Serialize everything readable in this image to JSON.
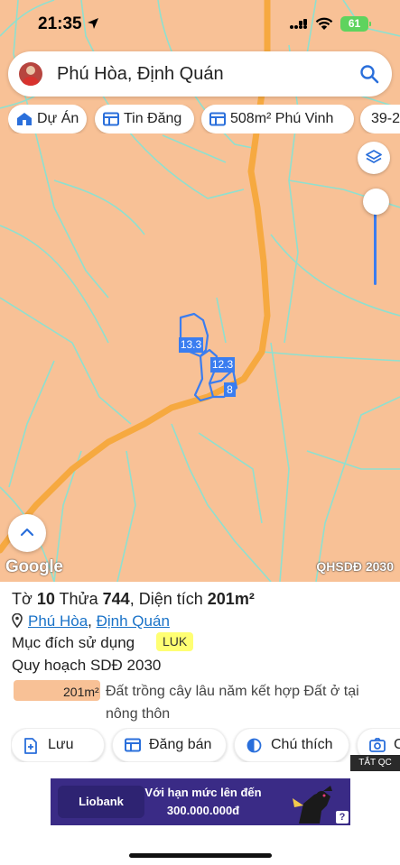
{
  "status": {
    "time": "21:35",
    "battery": "61"
  },
  "search": {
    "text": "Phú Hòa, Định Quán"
  },
  "chips": [
    {
      "label": "Dự Án",
      "icon": "house-icon"
    },
    {
      "label": "Tin Đăng",
      "icon": "listing-icon"
    },
    {
      "label": "508m² Phú Vinh",
      "icon": "listing-icon"
    },
    {
      "label": "39-2",
      "icon": "listing-icon"
    }
  ],
  "map": {
    "parcel_labels": [
      "13.3",
      "12.3",
      "8"
    ],
    "google": "Google",
    "layer_name": "QHSDĐ 2030",
    "colors": {
      "land": "#f8c196",
      "road": "#f6a940",
      "boundary": "#8fe0cf",
      "parcel": "#3a7df0"
    }
  },
  "panel": {
    "to_label": "Tờ",
    "to_value": "10",
    "thua_label": "Thửa",
    "thua_value": "744",
    "area_label": "Diện tích",
    "area_value": "201m²",
    "location_parts": [
      "Phú Hòa",
      "Định Quán"
    ],
    "purpose_label": "Mục đích sử dụng",
    "purpose_badge": "LUK",
    "plan_label": "Quy hoạch SDĐ 2030",
    "plan_area": "201m²",
    "plan_desc": "Đất trồng cây lâu năm kết hợp Đất ở tại nông thôn"
  },
  "actions": [
    {
      "label": "Lưu",
      "icon": "add-file-icon"
    },
    {
      "label": "Đăng bán",
      "icon": "listing-icon"
    },
    {
      "label": "Chú thích",
      "icon": "contrast-icon"
    },
    {
      "label": "C",
      "icon": "camera-icon"
    }
  ],
  "ad": {
    "close_label": "TẮT QC",
    "brand": "Liobank",
    "line1": "Với hạn mức lên đến",
    "line2": "300.000.000đ",
    "help": "?"
  }
}
